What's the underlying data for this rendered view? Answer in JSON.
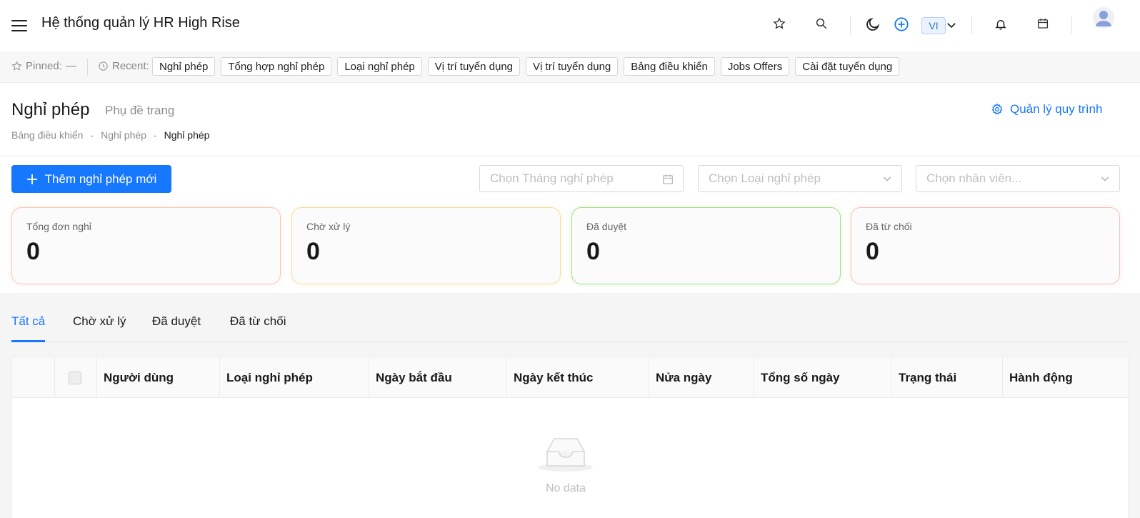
{
  "header": {
    "title": "Hệ thống quản lý HR High Rise",
    "language": "VI"
  },
  "recent_bar": {
    "pinned_label": "Pinned:",
    "pinned_value": "—",
    "recent_label": "Recent:",
    "chips": [
      "Nghỉ phép",
      "Tổng hợp nghỉ phép",
      "Loại nghỉ phép",
      "Vị trí tuyển dụng",
      "Vị trí tuyển dụng",
      "Bảng điều khiển",
      "Jobs Offers",
      "Cài đặt tuyển dụng"
    ]
  },
  "page": {
    "title": "Nghỉ phép",
    "subtitle": "Phụ đề trang",
    "manage_label": "Quản lý quy trình",
    "breadcrumb": [
      "Bảng điều khiển",
      "-",
      "Nghỉ phép",
      "-",
      "Nghỉ phép"
    ]
  },
  "toolbar": {
    "add_label": "Thêm nghỉ phép mới",
    "month_placeholder": "Chọn Tháng nghỉ phép",
    "type_placeholder": "Chọn Loại nghỉ phép",
    "employee_placeholder": "Chọn nhân viên..."
  },
  "stats": [
    {
      "label": "Tổng đơn nghỉ",
      "value": "0",
      "color": "#f7c9b3"
    },
    {
      "label": "Chờ xử lý",
      "value": "0",
      "color": "#f5df9c"
    },
    {
      "label": "Đã duyệt",
      "value": "0",
      "color": "#a9dd8b"
    },
    {
      "label": "Đã từ chối",
      "value": "0",
      "color": "#f5c2b6"
    }
  ],
  "tabs": [
    "Tất cả",
    "Chờ xử lý",
    "Đã duyệt",
    "Đã từ chối"
  ],
  "table": {
    "columns": [
      "Người dùng",
      "Loại nghỉ phép",
      "Ngày bắt đầu",
      "Ngày kết thúc",
      "Nửa ngày",
      "Tổng số ngày",
      "Trạng thái",
      "Hành động"
    ],
    "empty_text": "No data"
  },
  "colors": {
    "accent": "#1677ff"
  }
}
